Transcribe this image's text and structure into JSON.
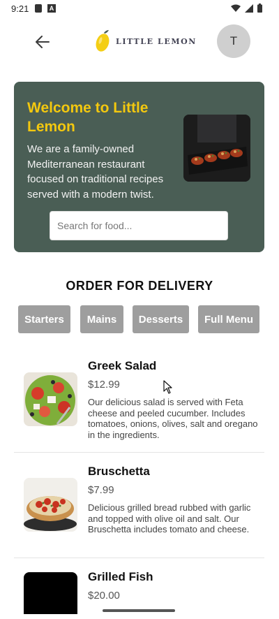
{
  "status_bar": {
    "time": "9:21"
  },
  "header": {
    "logo_text": "LITTLE LEMON",
    "avatar_initial": "T"
  },
  "hero": {
    "title": "Welcome to Little Lemon",
    "description": "We are a family-owned Mediterranean restaurant focused on traditional recipes served with a modern twist.",
    "search_placeholder": "Search for food..."
  },
  "order": {
    "title": "ORDER FOR DELIVERY",
    "categories": [
      "Starters",
      "Mains",
      "Desserts",
      "Full Menu"
    ]
  },
  "menu_items": [
    {
      "name": "Greek Salad",
      "price": "$12.99",
      "description": "Our delicious salad is served with Feta cheese and peeled cucumber. Includes tomatoes, onions, olives, salt and oregano in the ingredients."
    },
    {
      "name": "Bruschetta",
      "price": "$7.99",
      "description": "Delicious grilled bread rubbed with garlic and topped with olive oil and salt. Our Bruschetta includes tomato and cheese."
    },
    {
      "name": "Grilled Fish",
      "price": "$20.00"
    }
  ],
  "colors": {
    "hero_bg": "#4a5e55",
    "accent_yellow": "#f3c80f",
    "category_bg": "#9e9e9e"
  }
}
